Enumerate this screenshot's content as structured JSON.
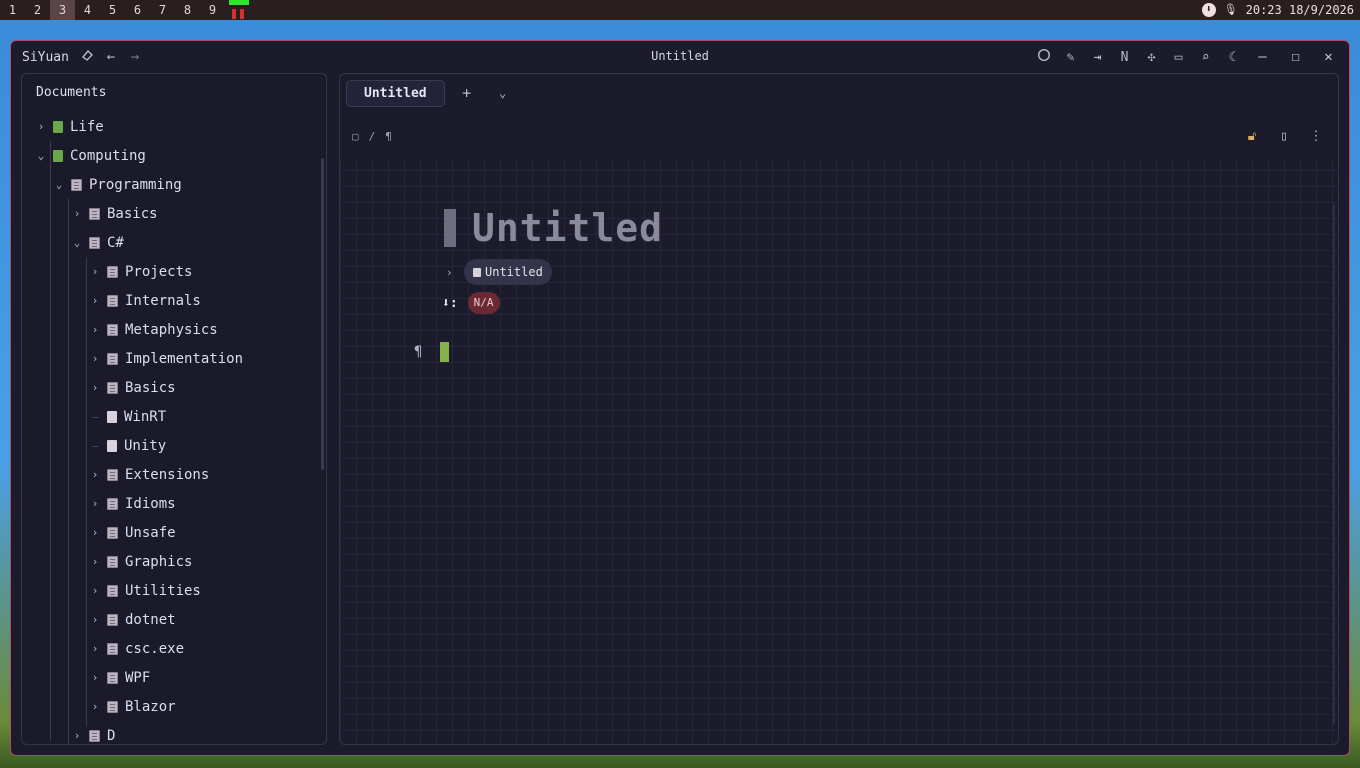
{
  "taskbar": {
    "workspaces": [
      "1",
      "2",
      "3",
      "4",
      "5",
      "6",
      "7",
      "8",
      "9"
    ],
    "active_workspace": "3",
    "clock": "20:23 18/9/2026"
  },
  "window": {
    "app_name": "SiYuan",
    "title": "Untitled"
  },
  "sidebar": {
    "header": "Documents",
    "items": [
      {
        "label": "Life",
        "depth": 0,
        "expand": "collapsed",
        "icon": "notebook-icon"
      },
      {
        "label": "Computing",
        "depth": 0,
        "expand": "expanded",
        "icon": "notebook-icon"
      },
      {
        "label": "Programming",
        "depth": 1,
        "expand": "expanded",
        "icon": "folder-doc-icon"
      },
      {
        "label": "Basics",
        "depth": 2,
        "expand": "collapsed",
        "icon": "folder-doc-icon"
      },
      {
        "label": "C#",
        "depth": 2,
        "expand": "expanded",
        "icon": "folder-doc-icon"
      },
      {
        "label": "Projects",
        "depth": 3,
        "expand": "collapsed",
        "icon": "folder-doc-icon"
      },
      {
        "label": "Internals",
        "depth": 3,
        "expand": "collapsed",
        "icon": "folder-doc-icon"
      },
      {
        "label": "Metaphysics",
        "depth": 3,
        "expand": "collapsed",
        "icon": "folder-doc-icon"
      },
      {
        "label": "Implementation",
        "depth": 3,
        "expand": "collapsed",
        "icon": "folder-doc-icon"
      },
      {
        "label": "Basics",
        "depth": 3,
        "expand": "collapsed",
        "icon": "folder-doc-icon"
      },
      {
        "label": "WinRT",
        "depth": 3,
        "expand": "none",
        "icon": "doc-icon"
      },
      {
        "label": "Unity",
        "depth": 3,
        "expand": "none",
        "icon": "doc-icon"
      },
      {
        "label": "Extensions",
        "depth": 3,
        "expand": "collapsed",
        "icon": "folder-doc-icon"
      },
      {
        "label": "Idioms",
        "depth": 3,
        "expand": "collapsed",
        "icon": "folder-doc-icon"
      },
      {
        "label": "Unsafe",
        "depth": 3,
        "expand": "collapsed",
        "icon": "folder-doc-icon"
      },
      {
        "label": "Graphics",
        "depth": 3,
        "expand": "collapsed",
        "icon": "folder-doc-icon"
      },
      {
        "label": "Utilities",
        "depth": 3,
        "expand": "collapsed",
        "icon": "folder-doc-icon"
      },
      {
        "label": "dotnet",
        "depth": 3,
        "expand": "collapsed",
        "icon": "folder-doc-icon"
      },
      {
        "label": "csc.exe",
        "depth": 3,
        "expand": "collapsed",
        "icon": "folder-doc-icon"
      },
      {
        "label": "WPF",
        "depth": 3,
        "expand": "collapsed",
        "icon": "folder-doc-icon"
      },
      {
        "label": "Blazor",
        "depth": 3,
        "expand": "collapsed",
        "icon": "folder-doc-icon"
      },
      {
        "label": "D",
        "depth": 2,
        "expand": "collapsed",
        "icon": "folder-doc-icon"
      }
    ]
  },
  "editor": {
    "tab_label": "Untitled",
    "breadcrumb_separator": "/",
    "doc_title": "Untitled",
    "backlink_label": "Untitled",
    "attr_key": "⬇:",
    "attr_value": "N/A"
  },
  "colors": {
    "window_border": "#b04a6a",
    "background": "#1c1b2c",
    "notebook_icon": "#6aa84a",
    "caret": "#86b04a",
    "attr_badge": "#6a2a34"
  }
}
